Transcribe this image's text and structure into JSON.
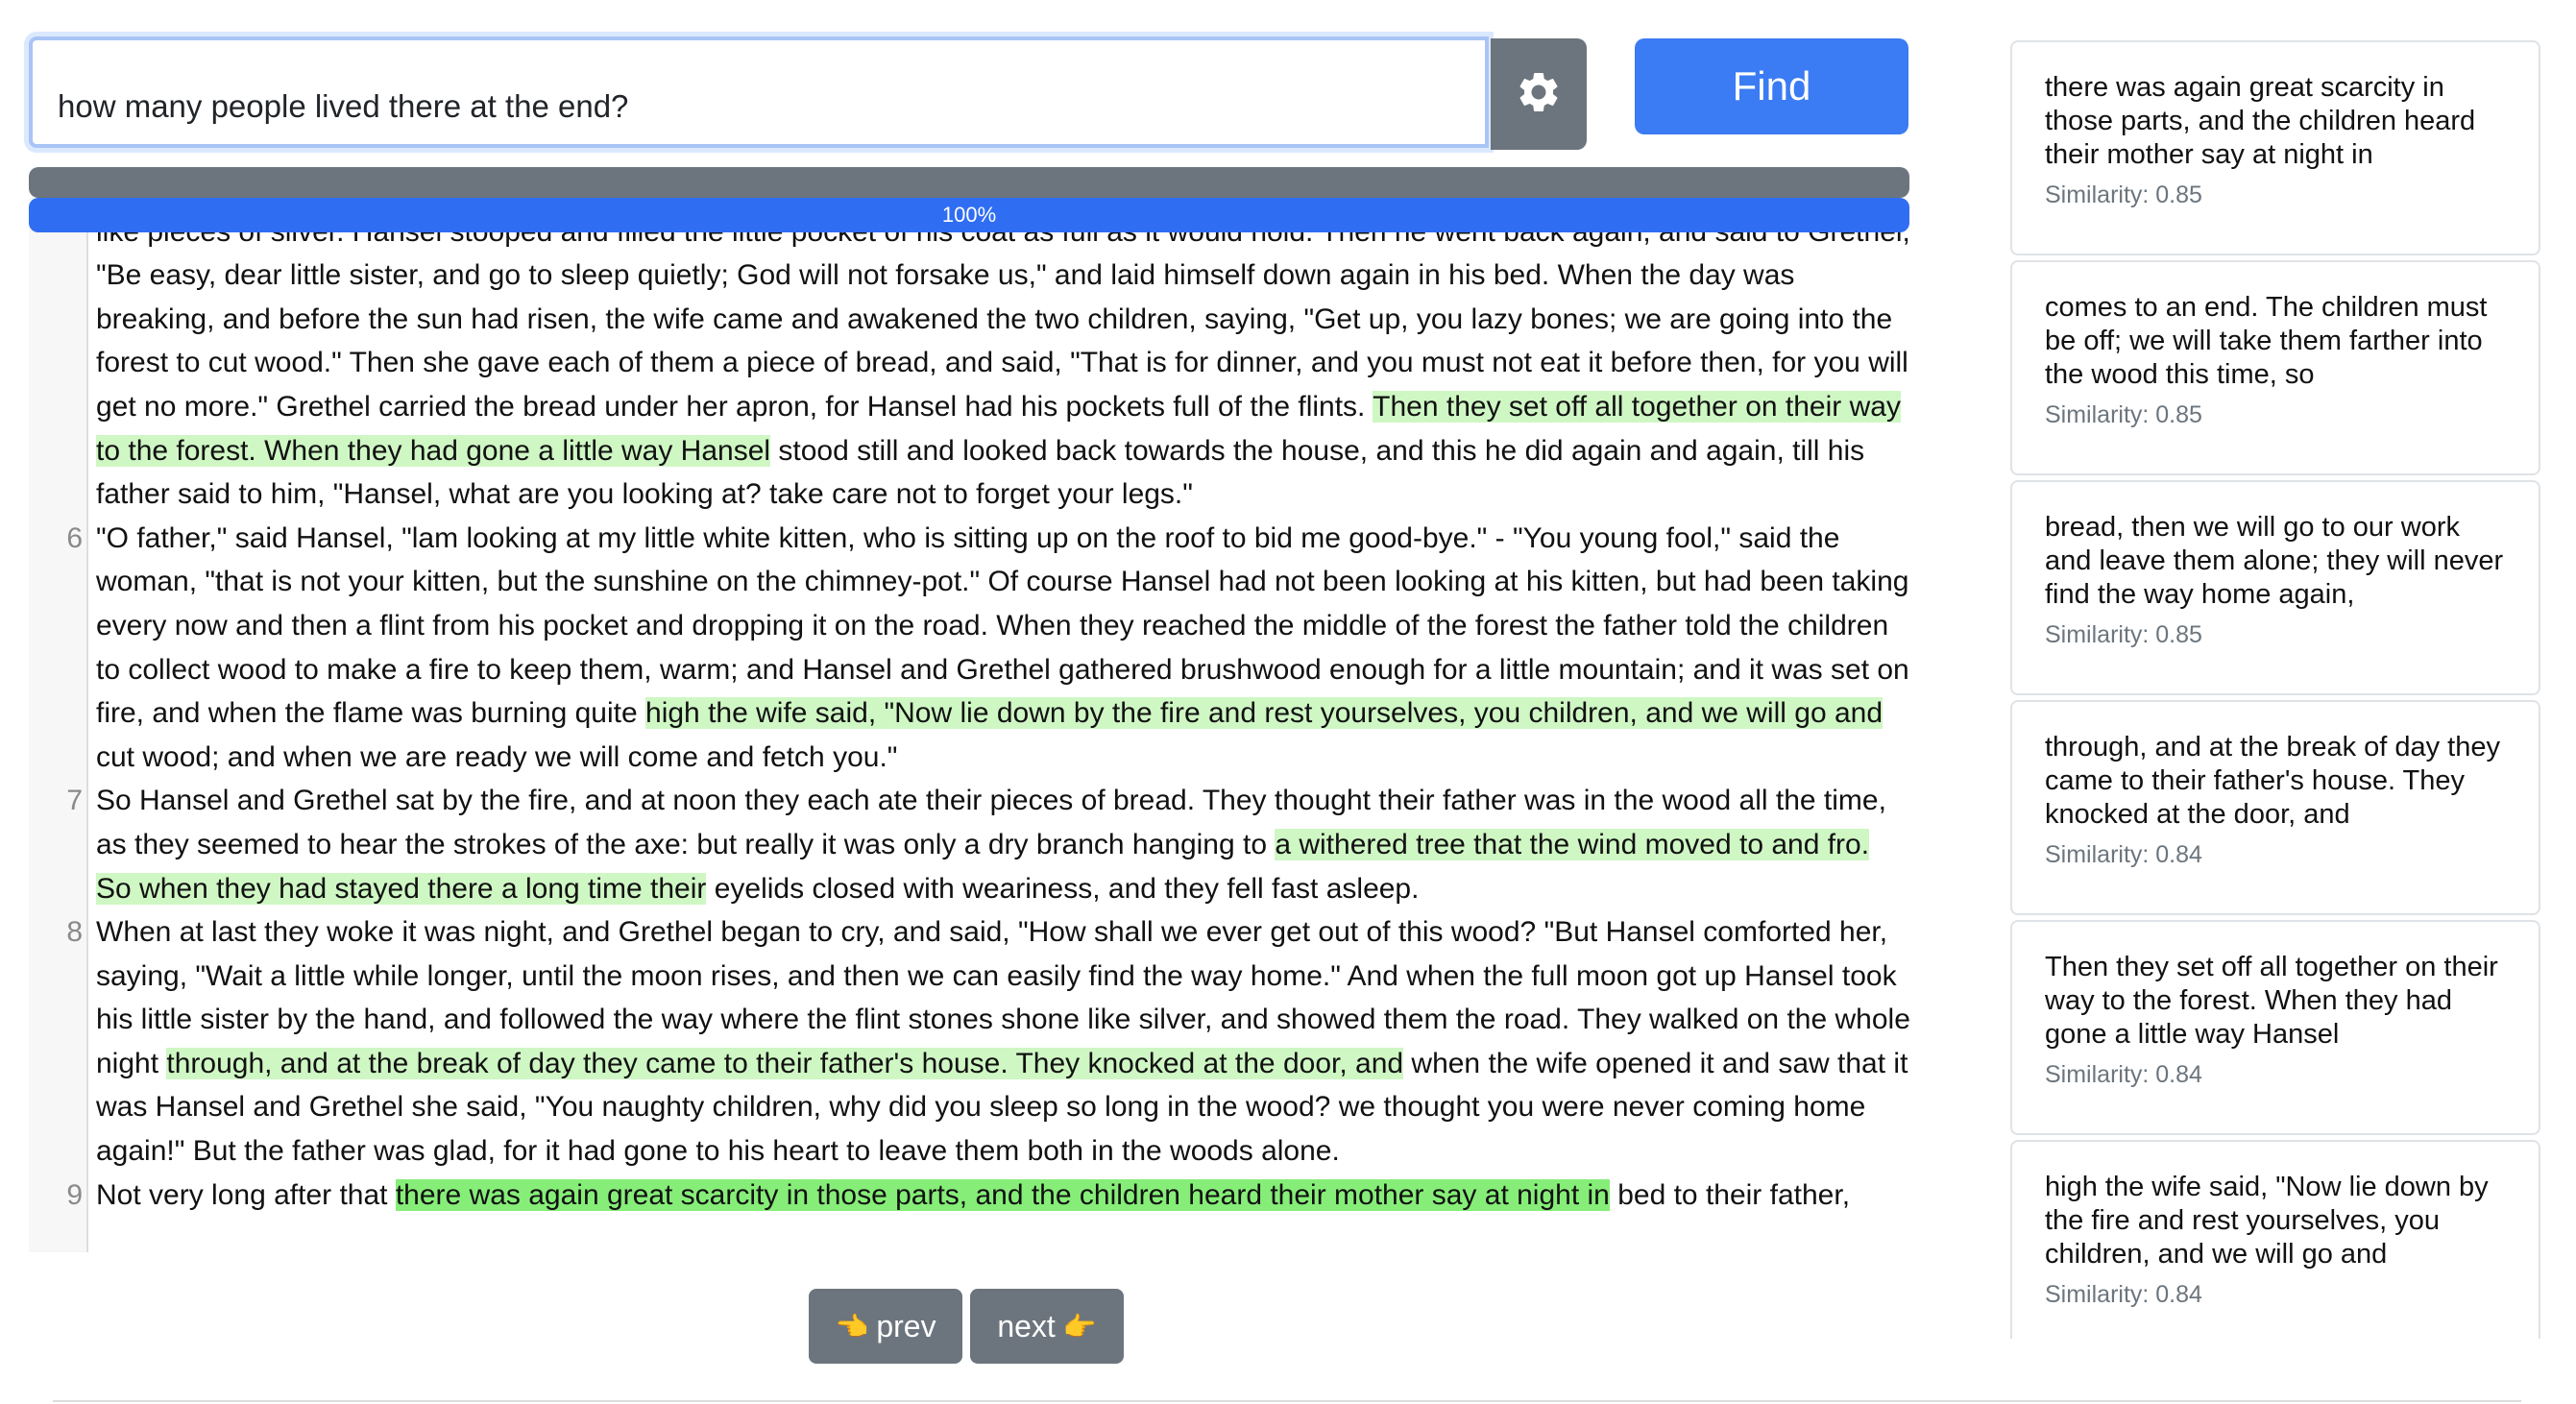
{
  "search": {
    "query": "how many people lived there at the end?",
    "settings_icon": "gear-icon",
    "find_label": "Find"
  },
  "progress": {
    "percent": 100,
    "label": "100%"
  },
  "document": {
    "paragraphs": [
      {
        "num": "",
        "segments": [
          {
            "t": "his little coat, opened the back door, and slipped out. The moon was shining brightly, and the white flints that lay in front of the house glistened like pieces of silver. Hansel stooped and filled the little pocket of his coat as full as it would hold. Then he went back again, and said to Grethel, \"Be easy, dear little sister, and go to sleep quietly; God will not forsake us,\" and laid himself down again in his bed. When the day was breaking, and before the sun had risen, the wife came and awakened the two children, saying, \"Get up, you lazy bones; we are going into the forest to cut wood.\" Then she gave each of them a piece of bread, and said, \"That is for dinner, and you must not eat it before then, for you will get no more.\" Grethel carried the bread under her apron, for Hansel had his pockets full of the flints. ",
            "h": ""
          },
          {
            "t": "Then they set off all together on their way to the forest. When they had gone a little way Hansel",
            "h": "hl"
          },
          {
            "t": " stood still and looked back towards the house, and this he did again and again, till his father said to him, \"Hansel, what are you looking at? take care not to forget your legs.\"",
            "h": ""
          }
        ]
      },
      {
        "num": "6",
        "segments": [
          {
            "t": "\"O father,\" said Hansel, \"lam looking at my little white kitten, who is sitting up on the roof to bid me good-bye.\" - \"You young fool,\" said the woman, \"that is not your kitten, but the sunshine on the chimney-pot.\" Of course Hansel had not been looking at his kitten, but had been taking every now and then a flint from his pocket and dropping it on the road. When they reached the middle of the forest the father told the children to collect wood to make a fire to keep them, warm; and Hansel and Grethel gathered brushwood enough for a little mountain; and it was set on fire, and when the flame was burning quite ",
            "h": ""
          },
          {
            "t": "high the wife said, \"Now lie down by the fire and rest yourselves, you children, and we will go and",
            "h": "hl"
          },
          {
            "t": " cut wood; and when we are ready we will come and fetch you.\"",
            "h": ""
          }
        ]
      },
      {
        "num": "7",
        "segments": [
          {
            "t": "So Hansel and Grethel sat by the fire, and at noon they each ate their pieces of bread. They thought their father was in the wood all the time, as they seemed to hear the strokes of the axe: but really it was only a dry branch hanging to ",
            "h": ""
          },
          {
            "t": "a withered tree that the wind moved to and fro. So when they had stayed there a long time their",
            "h": "hl"
          },
          {
            "t": " eyelids closed with weariness, and they fell fast asleep.",
            "h": ""
          }
        ]
      },
      {
        "num": "8",
        "segments": [
          {
            "t": "When at last they woke it was night, and Grethel began to cry, and said, \"How shall we ever get out of this wood? \"But Hansel comforted her, saying, \"Wait a little while longer, until the moon rises, and then we can easily find the way home.\" And when the full moon got up Hansel took his little sister by the hand, and followed the way where the flint stones shone like silver, and showed them the road. They walked on the whole night ",
            "h": ""
          },
          {
            "t": "through, and at the break of day they came to their father's house. They knocked at the door, and",
            "h": "hl"
          },
          {
            "t": " when the wife opened it and saw that it was Hansel and Grethel she said, \"You naughty children, why did you sleep so long in the wood? we thought you were never coming home again!\" But the father was glad, for it had gone to his heart to leave them both in the woods alone.",
            "h": ""
          }
        ]
      },
      {
        "num": "9",
        "segments": [
          {
            "t": "Not very long after that ",
            "h": ""
          },
          {
            "t": "there was again great scarcity in those parts, and the children heard their mother say at night in",
            "h": "hl-strong"
          },
          {
            "t": " bed to their father,",
            "h": ""
          }
        ]
      }
    ]
  },
  "pager": {
    "prev_label": "prev",
    "next_label": "next",
    "prev_icon": "left-pointing-hand-icon",
    "next_icon": "right-pointing-hand-icon"
  },
  "results": [
    {
      "text": "there was again great scarcity in those parts, and the children heard their mother say at night in",
      "similarity": "Similarity: 0.85"
    },
    {
      "text": "comes to an end. The children must be off; we will take them farther into the wood this time, so",
      "similarity": "Similarity: 0.85"
    },
    {
      "text": "bread, then we will go to our work and leave them alone; they will never find the way home again,",
      "similarity": "Similarity: 0.85"
    },
    {
      "text": "through, and at the break of day they came to their father's house. They knocked at the door, and",
      "similarity": "Similarity: 0.84"
    },
    {
      "text": "Then they set off all together on their way to the forest. When they had gone a little way Hansel",
      "similarity": "Similarity: 0.84"
    },
    {
      "text": "high the wife said, \"Now lie down by the fire and rest yourselves, you children, and we will go and",
      "similarity": "Similarity: 0.84"
    }
  ],
  "colors": {
    "primary": "#3b7bf3",
    "secondary": "#6c757d",
    "highlight": "#cff7c4",
    "highlight_strong": "#86ee78"
  }
}
